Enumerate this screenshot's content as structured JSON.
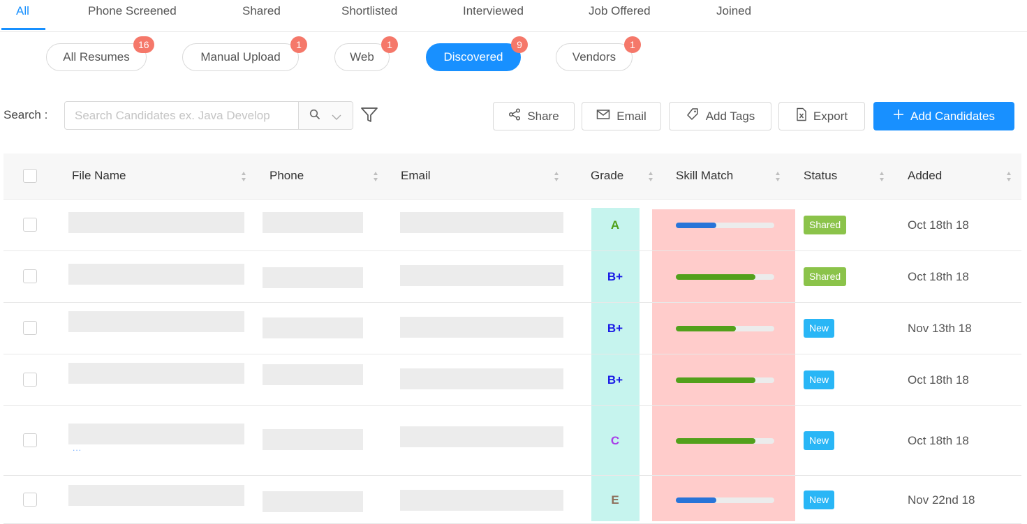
{
  "colors": {
    "primary": "#1890ff",
    "badge": "#f5786a",
    "grade_highlight": "#c6f4ee",
    "skill_highlight": "#ffcccb",
    "skill_high": "#52a01b",
    "skill_low": "#2874d8",
    "status_shared": "#8bc34a",
    "status_new": "#29b6f6"
  },
  "tabs": [
    {
      "label": "All",
      "active": true
    },
    {
      "label": "Phone Screened"
    },
    {
      "label": "Shared"
    },
    {
      "label": "Shortlisted"
    },
    {
      "label": "Interviewed"
    },
    {
      "label": "Job Offered"
    },
    {
      "label": "Joined"
    }
  ],
  "sources": [
    {
      "label": "All Resumes",
      "count": "16"
    },
    {
      "label": "Manual Upload",
      "count": "1"
    },
    {
      "label": "Web",
      "count": "1"
    },
    {
      "label": "Discovered",
      "count": "9",
      "active": true
    },
    {
      "label": "Vendors",
      "count": "1"
    }
  ],
  "search": {
    "label": "Search :",
    "placeholder": "Search Candidates ex. Java Develop",
    "search_icon": "search-icon",
    "dropdown_icon": "chevron-down-icon",
    "filter_icon": "filter-icon"
  },
  "toolbar": {
    "share": {
      "label": "Share",
      "icon": "share-icon"
    },
    "email": {
      "label": "Email",
      "icon": "mail-icon"
    },
    "tags": {
      "label": "Add Tags",
      "icon": "tag-icon"
    },
    "export": {
      "label": "Export",
      "icon": "file-excel-icon"
    },
    "add": {
      "label": "Add Candidates",
      "icon": "plus-icon"
    }
  },
  "table": {
    "columns": {
      "file_name": "File Name",
      "phone": "Phone",
      "email": "Email",
      "grade": "Grade",
      "skill_match": "Skill Match",
      "status": "Status",
      "added": "Added"
    },
    "rows": [
      {
        "grade": "A",
        "grade_color": "#52a01b",
        "skill": 0.41,
        "skill_level": "low",
        "status": "Shared",
        "added": "Oct 18th 18"
      },
      {
        "grade": "B+",
        "grade_color": "#1a1ae6",
        "skill": 0.81,
        "skill_level": "high",
        "status": "Shared",
        "added": "Oct 18th 18"
      },
      {
        "grade": "B+",
        "grade_color": "#1a1ae6",
        "skill": 0.61,
        "skill_level": "high",
        "status": "New",
        "added": "Nov 13th 18"
      },
      {
        "grade": "B+",
        "grade_color": "#1a1ae6",
        "skill": 0.81,
        "skill_level": "high",
        "status": "New",
        "added": "Oct 18th 18"
      },
      {
        "grade": "C",
        "grade_color": "#a83ee8",
        "skill": 0.81,
        "skill_level": "high",
        "status": "New",
        "added": "Oct 18th 18",
        "extra": "..."
      },
      {
        "grade": "E",
        "grade_color": "#8d6e5a",
        "skill": 0.41,
        "skill_level": "low",
        "status": "New",
        "added": "Nov 22nd 18"
      }
    ]
  }
}
